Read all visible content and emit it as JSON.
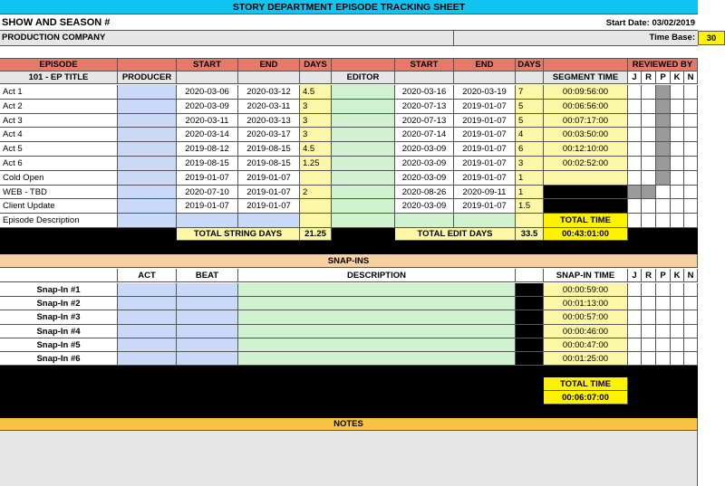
{
  "sheet_title": "STORY DEPARTMENT EPISODE TRACKING SHEET",
  "show_season": "SHOW AND SEASON #",
  "start_date": "Start Date: 03/02/2019",
  "production_company": "PRODUCTION COMPANY",
  "time_base_label": "Time Base:",
  "time_base_value": "30",
  "headers": {
    "episode": "EPISODE",
    "start": "START",
    "end": "END",
    "days": "DAYS",
    "reviewed_by": "REVIEWED BY",
    "ep_title": "101 - EP TITLE",
    "producer": "PRODUCER",
    "editor": "EDITOR",
    "segment_time": "SEGMENT TIME",
    "reviewers": [
      "J",
      "R",
      "P",
      "K",
      "N"
    ]
  },
  "rows": [
    {
      "name": "Act 1",
      "s1": "2020-03-06",
      "e1": "2020-03-12",
      "d1": "4.5",
      "s2": "2020-03-16",
      "e2": "2020-03-19",
      "d2": "7",
      "seg": "00:09:56:00"
    },
    {
      "name": "Act 2",
      "s1": "2020-03-09",
      "e1": "2020-03-11",
      "d1": "3",
      "s2": "2020-07-13",
      "e2": "2019-01-07",
      "d2": "5",
      "seg": "00:06:56:00"
    },
    {
      "name": "Act 3",
      "s1": "2020-03-11",
      "e1": "2020-03-13",
      "d1": "3",
      "s2": "2020-07-13",
      "e2": "2019-01-07",
      "d2": "5",
      "seg": "00:07:17:00"
    },
    {
      "name": "Act 4",
      "s1": "2020-03-14",
      "e1": "2020-03-17",
      "d1": "3",
      "s2": "2020-07-14",
      "e2": "2019-01-07",
      "d2": "4",
      "seg": "00:03:50:00"
    },
    {
      "name": "Act 5",
      "s1": "2019-08-12",
      "e1": "2019-08-15",
      "d1": "4.5",
      "s2": "2020-03-09",
      "e2": "2019-01-07",
      "d2": "6",
      "seg": "00:12:10:00"
    },
    {
      "name": "Act 6",
      "s1": "2019-08-15",
      "e1": "2019-08-15",
      "d1": "1.25",
      "s2": "2020-03-09",
      "e2": "2019-01-07",
      "d2": "3",
      "seg": "00:02:52:00"
    },
    {
      "name": "Cold Open",
      "s1": "2019-01-07",
      "e1": "2019-01-07",
      "d1": "",
      "s2": "2020-03-09",
      "e2": "2019-01-07",
      "d2": "1",
      "seg": ""
    },
    {
      "name": "WEB - TBD",
      "s1": "2020-07-10",
      "e1": "2019-01-07",
      "d1": "2",
      "s2": "2020-08-26",
      "e2": "2020-09-11",
      "d2": "1",
      "seg": ""
    },
    {
      "name": "Client Update",
      "s1": "2019-01-07",
      "e1": "2019-01-07",
      "d1": "",
      "s2": "2020-03-09",
      "e2": "2019-01-07",
      "d2": "1.5",
      "seg": ""
    },
    {
      "name": "Episode Description",
      "s1": "",
      "e1": "",
      "d1": "",
      "s2": "",
      "e2": "",
      "d2": "",
      "seg": "TOTAL TIME"
    }
  ],
  "totals": {
    "string_label": "TOTAL STRING DAYS",
    "string_value": "21.25",
    "edit_label": "TOTAL EDIT DAYS",
    "edit_value": "33.5",
    "total_time": "00:43:01:00"
  },
  "snapins": {
    "title": "SNAP-INS",
    "act": "ACT",
    "beat": "BEAT",
    "description": "DESCRIPTION",
    "snapin_time": "SNAP-IN TIME",
    "items": [
      {
        "name": "Snap-In #1",
        "time": "00:00:59:00"
      },
      {
        "name": "Snap-In #2",
        "time": "00:01:13:00"
      },
      {
        "name": "Snap-In #3",
        "time": "00:00:57:00"
      },
      {
        "name": "Snap-In #4",
        "time": "00:00:46:00"
      },
      {
        "name": "Snap-In #5",
        "time": "00:00:47:00"
      },
      {
        "name": "Snap-In #6",
        "time": "00:01:25:00"
      }
    ],
    "total_label": "TOTAL TIME",
    "total_value": "00:06:07:00"
  },
  "notes_title": "NOTES"
}
